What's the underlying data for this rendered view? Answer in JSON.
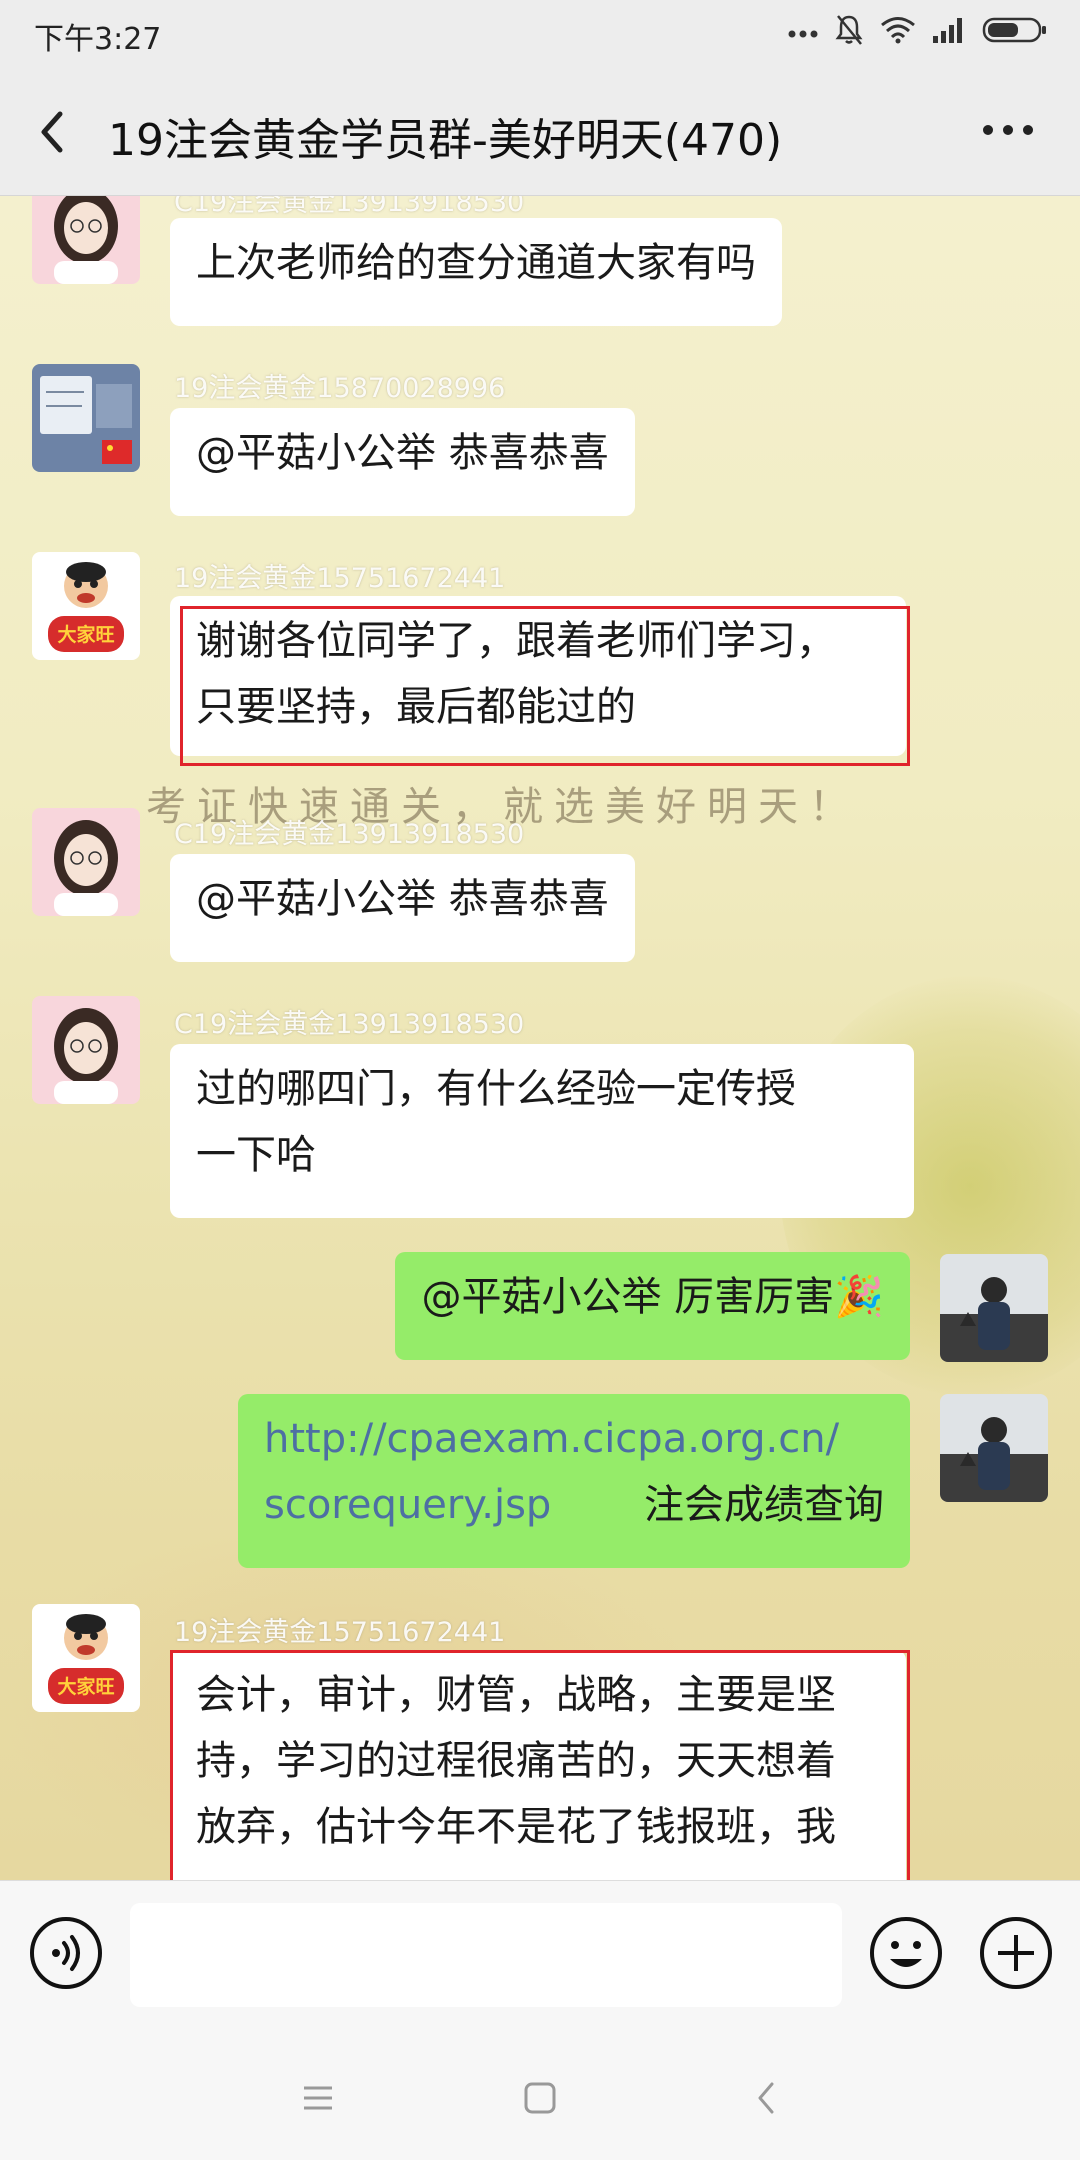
{
  "status_bar": {
    "time": "下午3:27",
    "icons": [
      "more-dots-icon",
      "mute-bell-icon",
      "wifi-icon",
      "signal-icon",
      "battery-icon"
    ]
  },
  "header": {
    "title": "19注会黄金学员群-美好明天(470)",
    "back_icon": "back-chevron-icon",
    "more_icon": "more-icon"
  },
  "watermark": "考证快速通关，就选美好明天！",
  "messages": [
    {
      "side": "left",
      "sender": "C19注会黄金13913918530",
      "lines": [
        "上次老师给的查分通道大家有吗"
      ],
      "highlighted": false
    },
    {
      "side": "left",
      "sender": "19注会黄金15870028996",
      "lines": [
        "@平菇小公举  恭喜恭喜"
      ],
      "highlighted": false
    },
    {
      "side": "left",
      "sender": "19注会黄金15751672441",
      "lines": [
        "谢谢各位同学了，跟着老师们学习，",
        "只要坚持，最后都能过的"
      ],
      "highlighted": true
    },
    {
      "side": "left",
      "sender": "C19注会黄金13913918530",
      "lines": [
        "@平菇小公举  恭喜恭喜"
      ],
      "highlighted": false
    },
    {
      "side": "left",
      "sender": "C19注会黄金13913918530",
      "lines": [
        "过的哪四门，有什么经验一定传授",
        "一下哈"
      ],
      "highlighted": false
    },
    {
      "side": "right",
      "lines": [
        "@平菇小公举  厉害厉害🎉"
      ]
    },
    {
      "side": "right",
      "link_line1": "http://cpaexam.cicpa.org.cn/",
      "link_line2": "scorequery.jsp",
      "link_caption": "注会成绩查询"
    },
    {
      "side": "left",
      "sender": "19注会黄金15751672441",
      "lines": [
        "会计，审计，财管，战略，主要是坚",
        "持，学习的过程很痛苦的，天天想着",
        "放弃，估计今年不是花了钱报班，我"
      ],
      "highlighted": true
    }
  ],
  "input_bar": {
    "voice_icon": "voice-icon",
    "input_value": "",
    "emoji_icon": "emoji-icon",
    "plus_icon": "plus-icon"
  },
  "nav_bar": {
    "icons": [
      "menu-icon",
      "home-icon",
      "back-icon"
    ]
  },
  "colors": {
    "sent_bubble": "#95ec69",
    "received_bubble": "#ffffff",
    "highlight_border": "#e0242b",
    "link": "#4d6fa3"
  }
}
